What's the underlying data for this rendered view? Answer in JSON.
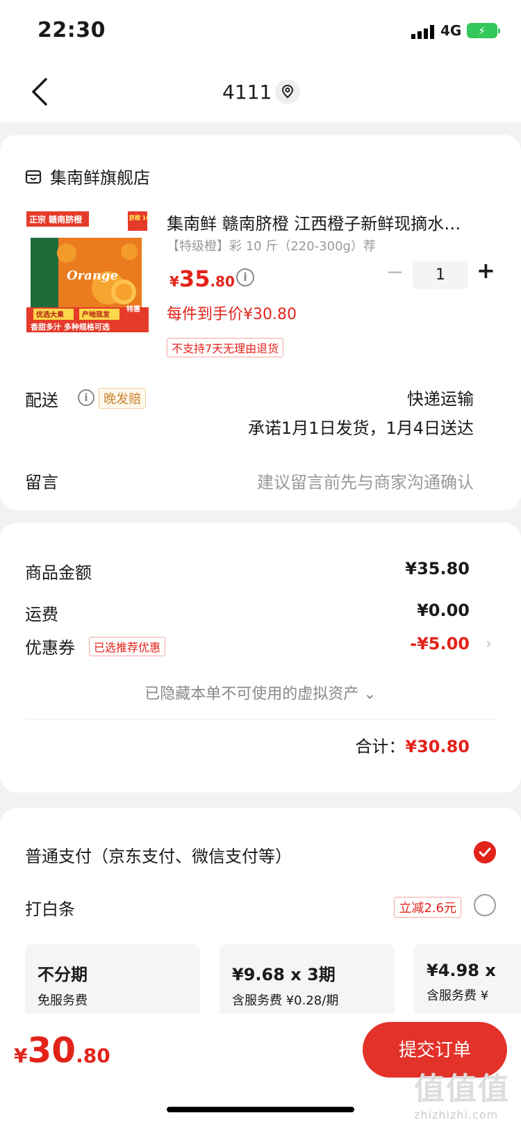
{
  "status_bar": {
    "time": "22:30",
    "network": "4G"
  },
  "nav": {
    "title": "4111"
  },
  "store": {
    "name": "集南鲜旗舰店",
    "product": {
      "title": "集南鲜 赣南脐橙 江西橙子新鲜现摘水…",
      "spec": "【特级橙】彩 10 斤（220-300g）荐",
      "price_symbol": "¥",
      "price_int": "35",
      "price_dec": ".80",
      "quantity": "1",
      "final_price": "每件到手价¥30.80",
      "return_tag": "不支持7天无理由退货",
      "image_texts": {
        "tag_left": "正宗 赣南脐橙",
        "tag_right": "脐橙 10W+",
        "brand": "Orange",
        "badge": "特惠",
        "slogan1": "优选大果",
        "slogan2": "产地现发",
        "slogan3": "香甜多汁  多种规格可选"
      }
    },
    "shipping": {
      "label": "配送",
      "tag": "晚发赔",
      "type": "快递运输",
      "promise": "承诺1月1日发货，1月4日送达"
    },
    "message": {
      "label": "留言",
      "placeholder": "建议留言前先与商家沟通确认"
    }
  },
  "amounts": {
    "goods_label": "商品金额",
    "goods_value": "¥35.80",
    "freight_label": "运费",
    "freight_value": "¥0.00",
    "coupon_label": "优惠券",
    "coupon_tag": "已选推荐优惠",
    "coupon_value": "-¥5.00",
    "hidden_note": "已隐藏本单不可使用的虚拟资产 ⌄",
    "total_label": "合计：",
    "total_value": "¥30.80"
  },
  "payment": {
    "normal_label": "普通支付（京东支付、微信支付等）",
    "baitiao_label": "打白条",
    "baitiao_tag": "立减2.6元",
    "plans": [
      {
        "title": "不分期",
        "sub": "免服务费"
      },
      {
        "title": "¥9.68 x 3期",
        "sub": "含服务费 ¥0.28/期"
      },
      {
        "title": "¥4.98 x",
        "sub": "含服务费 ¥"
      }
    ]
  },
  "bottom": {
    "price_symbol": "¥",
    "price_int": "30",
    "price_dec": ".80",
    "submit_label": "提交订单",
    "watermark": "值值值",
    "watermark_url": "zhizhizhi.com"
  },
  "colors": {
    "accent": "#e2231a",
    "battery": "#34c759"
  }
}
